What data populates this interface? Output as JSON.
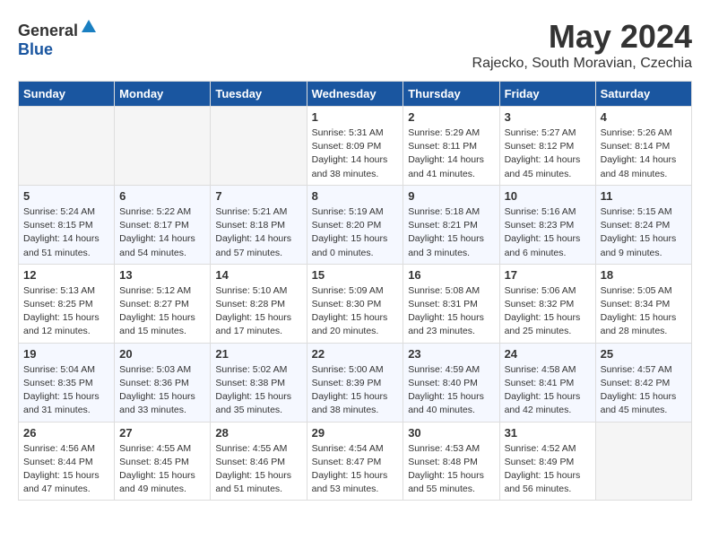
{
  "header": {
    "logo_general": "General",
    "logo_blue": "Blue",
    "month": "May 2024",
    "location": "Rajecko, South Moravian, Czechia"
  },
  "weekdays": [
    "Sunday",
    "Monday",
    "Tuesday",
    "Wednesday",
    "Thursday",
    "Friday",
    "Saturday"
  ],
  "weeks": [
    [
      {
        "day": "",
        "info": ""
      },
      {
        "day": "",
        "info": ""
      },
      {
        "day": "",
        "info": ""
      },
      {
        "day": "1",
        "info": "Sunrise: 5:31 AM\nSunset: 8:09 PM\nDaylight: 14 hours\nand 38 minutes."
      },
      {
        "day": "2",
        "info": "Sunrise: 5:29 AM\nSunset: 8:11 PM\nDaylight: 14 hours\nand 41 minutes."
      },
      {
        "day": "3",
        "info": "Sunrise: 5:27 AM\nSunset: 8:12 PM\nDaylight: 14 hours\nand 45 minutes."
      },
      {
        "day": "4",
        "info": "Sunrise: 5:26 AM\nSunset: 8:14 PM\nDaylight: 14 hours\nand 48 minutes."
      }
    ],
    [
      {
        "day": "5",
        "info": "Sunrise: 5:24 AM\nSunset: 8:15 PM\nDaylight: 14 hours\nand 51 minutes."
      },
      {
        "day": "6",
        "info": "Sunrise: 5:22 AM\nSunset: 8:17 PM\nDaylight: 14 hours\nand 54 minutes."
      },
      {
        "day": "7",
        "info": "Sunrise: 5:21 AM\nSunset: 8:18 PM\nDaylight: 14 hours\nand 57 minutes."
      },
      {
        "day": "8",
        "info": "Sunrise: 5:19 AM\nSunset: 8:20 PM\nDaylight: 15 hours\nand 0 minutes."
      },
      {
        "day": "9",
        "info": "Sunrise: 5:18 AM\nSunset: 8:21 PM\nDaylight: 15 hours\nand 3 minutes."
      },
      {
        "day": "10",
        "info": "Sunrise: 5:16 AM\nSunset: 8:23 PM\nDaylight: 15 hours\nand 6 minutes."
      },
      {
        "day": "11",
        "info": "Sunrise: 5:15 AM\nSunset: 8:24 PM\nDaylight: 15 hours\nand 9 minutes."
      }
    ],
    [
      {
        "day": "12",
        "info": "Sunrise: 5:13 AM\nSunset: 8:25 PM\nDaylight: 15 hours\nand 12 minutes."
      },
      {
        "day": "13",
        "info": "Sunrise: 5:12 AM\nSunset: 8:27 PM\nDaylight: 15 hours\nand 15 minutes."
      },
      {
        "day": "14",
        "info": "Sunrise: 5:10 AM\nSunset: 8:28 PM\nDaylight: 15 hours\nand 17 minutes."
      },
      {
        "day": "15",
        "info": "Sunrise: 5:09 AM\nSunset: 8:30 PM\nDaylight: 15 hours\nand 20 minutes."
      },
      {
        "day": "16",
        "info": "Sunrise: 5:08 AM\nSunset: 8:31 PM\nDaylight: 15 hours\nand 23 minutes."
      },
      {
        "day": "17",
        "info": "Sunrise: 5:06 AM\nSunset: 8:32 PM\nDaylight: 15 hours\nand 25 minutes."
      },
      {
        "day": "18",
        "info": "Sunrise: 5:05 AM\nSunset: 8:34 PM\nDaylight: 15 hours\nand 28 minutes."
      }
    ],
    [
      {
        "day": "19",
        "info": "Sunrise: 5:04 AM\nSunset: 8:35 PM\nDaylight: 15 hours\nand 31 minutes."
      },
      {
        "day": "20",
        "info": "Sunrise: 5:03 AM\nSunset: 8:36 PM\nDaylight: 15 hours\nand 33 minutes."
      },
      {
        "day": "21",
        "info": "Sunrise: 5:02 AM\nSunset: 8:38 PM\nDaylight: 15 hours\nand 35 minutes."
      },
      {
        "day": "22",
        "info": "Sunrise: 5:00 AM\nSunset: 8:39 PM\nDaylight: 15 hours\nand 38 minutes."
      },
      {
        "day": "23",
        "info": "Sunrise: 4:59 AM\nSunset: 8:40 PM\nDaylight: 15 hours\nand 40 minutes."
      },
      {
        "day": "24",
        "info": "Sunrise: 4:58 AM\nSunset: 8:41 PM\nDaylight: 15 hours\nand 42 minutes."
      },
      {
        "day": "25",
        "info": "Sunrise: 4:57 AM\nSunset: 8:42 PM\nDaylight: 15 hours\nand 45 minutes."
      }
    ],
    [
      {
        "day": "26",
        "info": "Sunrise: 4:56 AM\nSunset: 8:44 PM\nDaylight: 15 hours\nand 47 minutes."
      },
      {
        "day": "27",
        "info": "Sunrise: 4:55 AM\nSunset: 8:45 PM\nDaylight: 15 hours\nand 49 minutes."
      },
      {
        "day": "28",
        "info": "Sunrise: 4:55 AM\nSunset: 8:46 PM\nDaylight: 15 hours\nand 51 minutes."
      },
      {
        "day": "29",
        "info": "Sunrise: 4:54 AM\nSunset: 8:47 PM\nDaylight: 15 hours\nand 53 minutes."
      },
      {
        "day": "30",
        "info": "Sunrise: 4:53 AM\nSunset: 8:48 PM\nDaylight: 15 hours\nand 55 minutes."
      },
      {
        "day": "31",
        "info": "Sunrise: 4:52 AM\nSunset: 8:49 PM\nDaylight: 15 hours\nand 56 minutes."
      },
      {
        "day": "",
        "info": ""
      }
    ]
  ]
}
